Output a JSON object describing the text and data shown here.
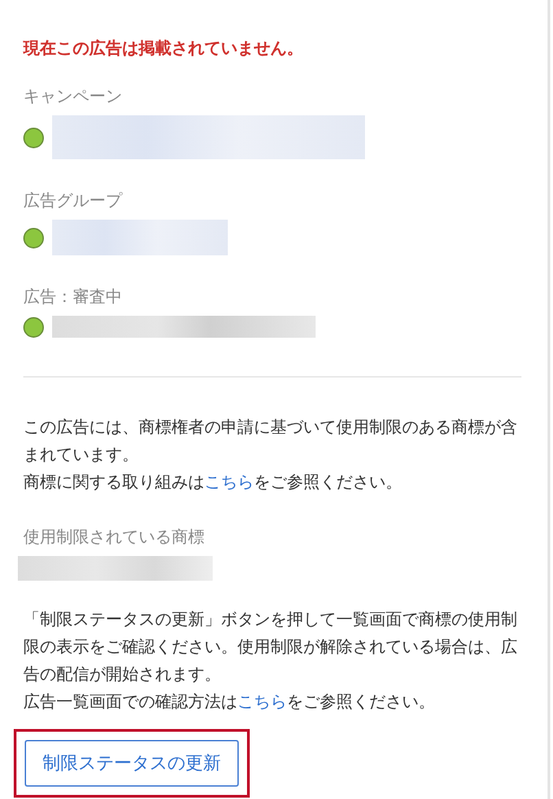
{
  "alert": "現在この広告は掲載されていません。",
  "entities": [
    {
      "label": "キャンペーン",
      "color": "#8cc63f"
    },
    {
      "label": "広告グループ",
      "color": "#8cc63f"
    },
    {
      "label": "広告：審査中",
      "color": "#8cc63f"
    }
  ],
  "notice": [
    {
      "kind": "text",
      "text": "この広告には、商標権者の申請に基づいて使用制限のある商標が含まれています。"
    },
    {
      "kind": "break"
    },
    {
      "kind": "text",
      "text": "商標に関する取り組みは"
    },
    {
      "kind": "link",
      "text": "こちら"
    },
    {
      "kind": "text",
      "text": "をご参照ください。"
    }
  ],
  "restricted_label": "使用制限されている商標",
  "instructions": [
    {
      "kind": "text",
      "text": "「制限ステータスの更新」ボタンを押して一覧画面で商標の使用制限の表示をご確認ください。使用制限が解除されている場合は、広告の配信が開始されます。"
    },
    {
      "kind": "break"
    },
    {
      "kind": "text",
      "text": "広告一覧画面での確認方法は"
    },
    {
      "kind": "link",
      "text": "こちら"
    },
    {
      "kind": "text",
      "text": "をご参照ください。"
    }
  ],
  "button": {
    "label": "制限ステータスの更新",
    "highlighted": true
  }
}
